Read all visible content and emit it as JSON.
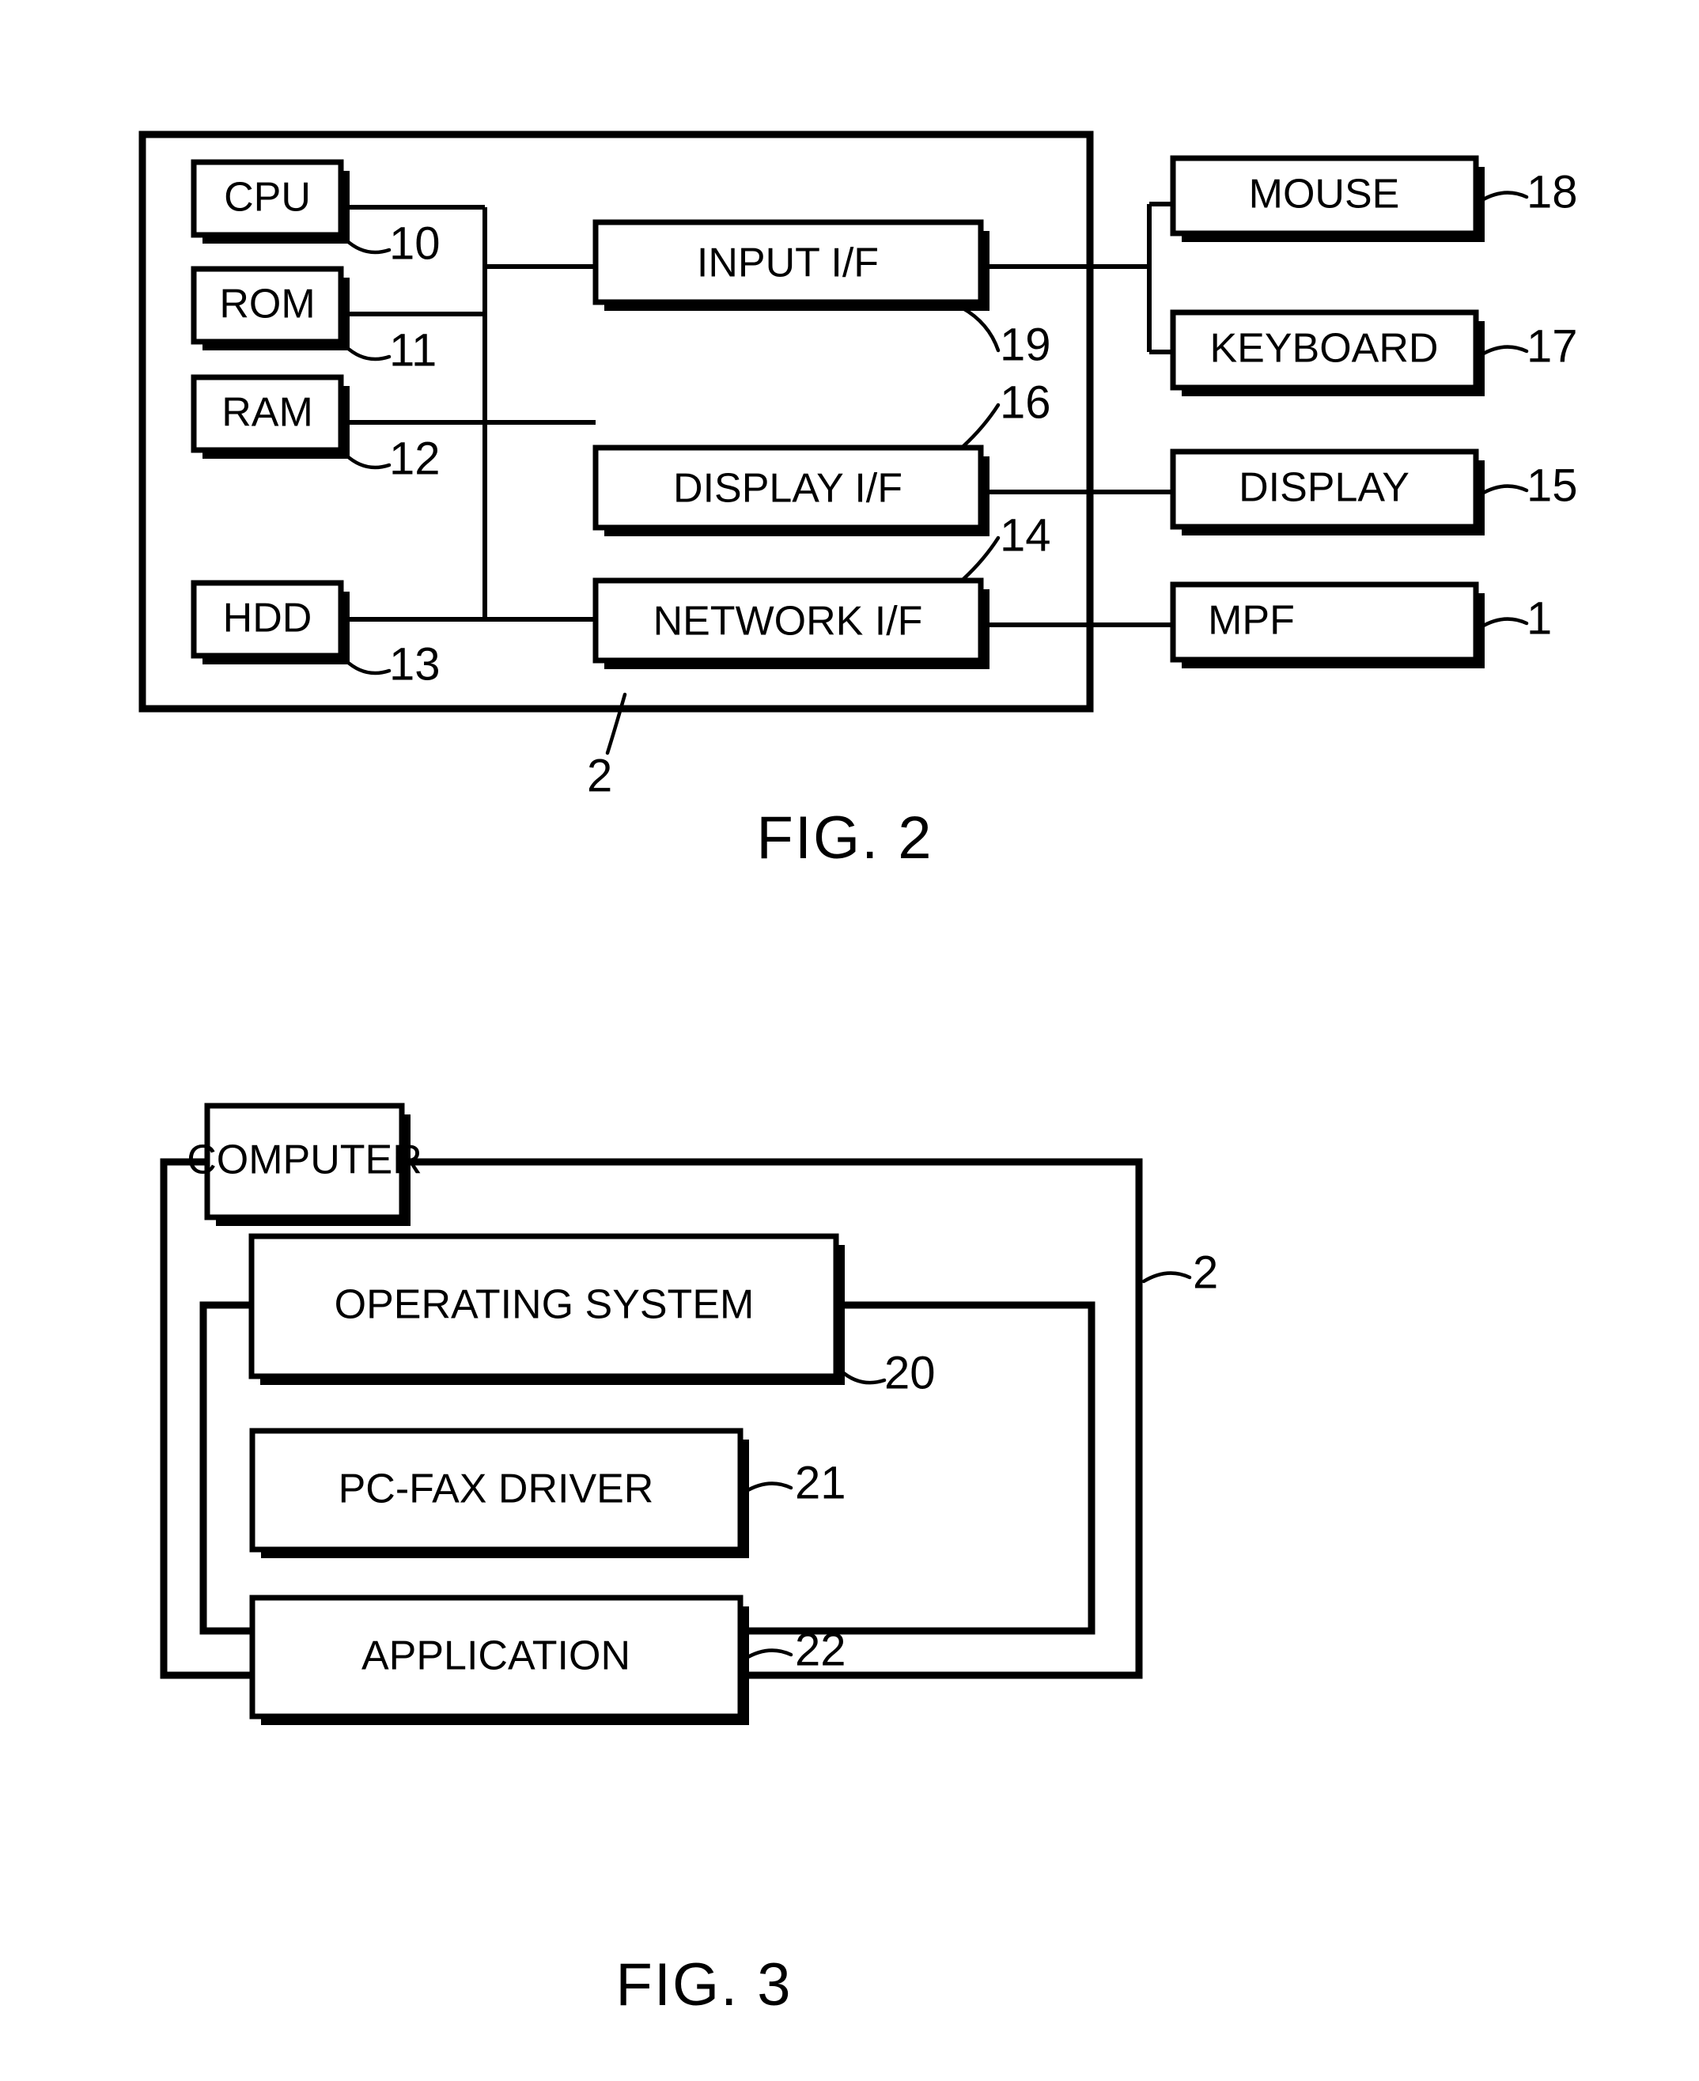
{
  "document": {
    "type": "patent-drawing-sheet",
    "figures": [
      {
        "id": "fig2",
        "caption": "FIG. 2",
        "outer_container_ref": "2",
        "blocks": [
          {
            "key": "cpu",
            "label": "CPU",
            "ref": "10"
          },
          {
            "key": "rom",
            "label": "ROM",
            "ref": "11"
          },
          {
            "key": "ram",
            "label": "RAM",
            "ref": "12"
          },
          {
            "key": "hdd",
            "label": "HDD",
            "ref": "13"
          },
          {
            "key": "input_if",
            "label": "INPUT I/F",
            "ref": "19"
          },
          {
            "key": "display_if",
            "label": "DISPLAY I/F",
            "ref": "16"
          },
          {
            "key": "network_if",
            "label": "NETWORK I/F",
            "ref": "14"
          },
          {
            "key": "mouse",
            "label": "MOUSE",
            "ref": "18"
          },
          {
            "key": "keyboard",
            "label": "KEYBOARD",
            "ref": "17"
          },
          {
            "key": "display",
            "label": "DISPLAY",
            "ref": "15"
          },
          {
            "key": "mpf",
            "label": "MPF",
            "ref": "1"
          }
        ]
      },
      {
        "id": "fig3",
        "caption": "FIG. 3",
        "outer_container_ref": "2",
        "blocks": [
          {
            "key": "computer",
            "label": "COMPUTER",
            "ref": ""
          },
          {
            "key": "os",
            "label": "OPERATING SYSTEM",
            "ref": "20"
          },
          {
            "key": "pcfax",
            "label": "PC-FAX DRIVER",
            "ref": "21"
          },
          {
            "key": "application",
            "label": "APPLICATION",
            "ref": "22"
          }
        ]
      }
    ],
    "colors": {
      "ink": "#000000",
      "paper": "#ffffff"
    }
  }
}
